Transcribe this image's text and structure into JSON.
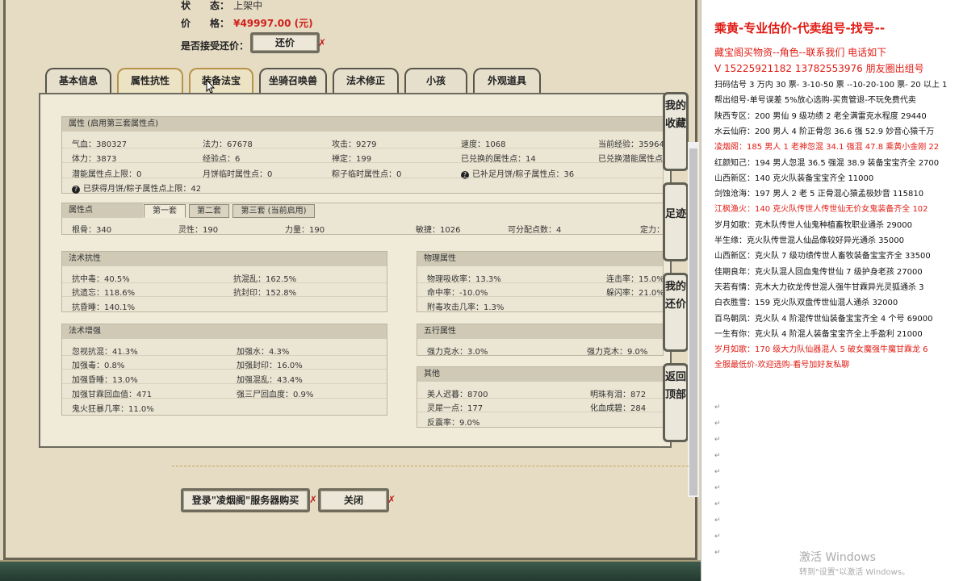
{
  "header": {
    "status_label": "状　　态：",
    "status_value": "上架中",
    "price_label": "价　　格：",
    "price_value": "¥49997.00 (元)",
    "counter_label": "是否接受还价：",
    "counter_button": "还价",
    "close_mark": "✗"
  },
  "tabs": [
    "基本信息",
    "属性抗性",
    "装备法宝",
    "坐骑召唤兽",
    "法术修正",
    "小孩",
    "外观道具"
  ],
  "attr_group": {
    "title": "属性 (启用第三套属性点)",
    "rows": [
      [
        "气血：380327",
        "法力：67678",
        "攻击：9279",
        "速度：1068",
        "当前经验：35964"
      ],
      [
        "体力：3873",
        "经验点：6",
        "禅定：199",
        "已兑换的属性点：14",
        "已兑换潜能属性点"
      ],
      [
        "潜能属性点上限：0",
        "月饼临时属性点：0",
        "粽子临时属性点：0",
        "已补足月饼/粽子属性点：36",
        ""
      ],
      [
        "已获得月饼/粽子属性点上限：42",
        "",
        "",
        "",
        ""
      ]
    ]
  },
  "points_group": {
    "title": "属性点",
    "subtabs": [
      "第一套",
      "第二套",
      "第三套 (当前启用)"
    ],
    "row": [
      "根骨：340",
      "灵性：190",
      "力量：190",
      "敏捷：1026",
      "可分配点数：4",
      "定力："
    ]
  },
  "resist_group": {
    "title": "法术抗性",
    "rows": [
      [
        "抗中毒：40.5%",
        "抗混乱：162.5%"
      ],
      [
        "抗遗忘：118.6%",
        "抗封印：152.8%"
      ],
      [
        "抗昏睡：140.1%",
        ""
      ]
    ]
  },
  "enhance_group": {
    "title": "法术增强",
    "rows": [
      [
        "忽视抗混：41.3%",
        "加强水：4.3%"
      ],
      [
        "加强毒：0.8%",
        "加强封印：16.0%"
      ],
      [
        "加强昏睡：13.0%",
        "加强混乱：43.4%"
      ],
      [
        "加强甘霖回血值：471",
        "强三尸回血度：0.9%"
      ],
      [
        "鬼火狂暴几率：11.0%",
        ""
      ]
    ]
  },
  "physical_group": {
    "title": "物理属性",
    "rows": [
      [
        "物理吸收率：13.3%",
        "连击率：15.0%"
      ],
      [
        "命中率：-10.0%",
        "躲闪率：21.0%"
      ],
      [
        "附毒攻击几率：1.3%",
        ""
      ]
    ]
  },
  "element_group": {
    "title": "五行属性",
    "rows": [
      [
        "强力克水：3.0%",
        "强力克木：9.0%"
      ]
    ]
  },
  "other_group": {
    "title": "其他",
    "rows": [
      [
        "美人迟暮：8700",
        "明珠有泪：872"
      ],
      [
        "灵犀一点：177",
        "化血成碧：284"
      ],
      [
        "反震率：9.0%",
        ""
      ]
    ]
  },
  "side_buttons": [
    "我的收藏",
    "足迹",
    "我的还价",
    "返回顶部"
  ],
  "footer": {
    "login_button": "登录\"凌烟阁\"服务器购买",
    "close_button": "关闭"
  },
  "doc": {
    "title": "乘黄-专业估价-代卖组号-找号--",
    "lines": [
      {
        "text": "藏宝阁买物资--角色--联系我们 电话如下",
        "red": true
      },
      {
        "text": "V 15225921182  13782553976 朋友圈出组号",
        "red": true
      },
      {
        "text": "扫码估号 3 万内 30 票- 3-10-50 票 --10-20-100 票- 20 以上 1",
        "red": false
      },
      {
        "text": "帮出组号-单号误差 5%放心选购-买贵管退-不玩免费代卖",
        "red": false
      },
      {
        "text": "陕西专区：200 男仙 9 级功绩 2 老全满雷克水程度 29440",
        "red": false
      },
      {
        "text": "水云仙府：200 男人 4 阶正骨忽 36.6 强 52.9 妙音心猿千万",
        "red": false
      },
      {
        "text": "凌烟阁：185 男人 1 老神忽混 34.1 强混 47.8 乘黄小金刚 22",
        "red": true
      },
      {
        "text": "红颜知己：194 男人忽混 36.5 强混 38.9 装备宝宝齐全 2700",
        "red": false
      },
      {
        "text": "山西新区：140 克火队装备宝宝齐全 11000",
        "red": false
      },
      {
        "text": "剑蚀沧海：197 男人 2 老 5 正骨混心猿孟极妙音 115810",
        "red": false
      },
      {
        "text": "江枫渔火：140 克火队传世人传世仙无价女鬼装备齐全 102",
        "red": true
      },
      {
        "text": "岁月如歌：克木队传世人仙鬼种植畜牧职业通杀 29000",
        "red": false
      },
      {
        "text": "半生缘：克火队传世混人仙品像较好异光通杀 35000",
        "red": false
      },
      {
        "text": "山西新区：克火队 7 级功绩传世人畜牧装备宝宝齐全 33500",
        "red": false
      },
      {
        "text": "佳期良年：克火队混人回血鬼传世仙 7 级护身老孩 27000",
        "red": false
      },
      {
        "text": "天若有情：克木大力砍龙传世混人强牛甘霖异光灵狐通杀 3",
        "red": false
      },
      {
        "text": "白衣胜雪：159 克火队双盘传世仙混人通杀 32000",
        "red": false
      },
      {
        "text": "百鸟朝凤：克火队 4 阶混传世仙装备宝宝齐全 4 个号 69000",
        "red": false
      },
      {
        "text": "一生有你：克火队 4 阶混人装备宝宝齐全上手盈利 21000",
        "red": false
      },
      {
        "text": "岁月如歌：170 级大力队仙器混人 5 破女魔强牛魔甘霖龙 6",
        "red": true
      },
      {
        "text": "全服最低价-欢迎选购-看号加好友私聊",
        "red": true
      }
    ],
    "watermark_title": "激活 Windows",
    "watermark_sub": "转到\"设置\"以激活 Windows。"
  },
  "colors": {
    "accent_red": "#e01a12",
    "frame_dark": "#1f3a2e",
    "panel_bg": "#f0ead9"
  }
}
